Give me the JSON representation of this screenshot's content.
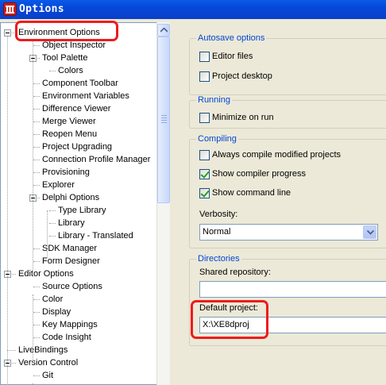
{
  "window": {
    "title": "Options"
  },
  "tree": {
    "items": [
      {
        "label": "Environment Options",
        "level": 0,
        "expanded": true
      },
      {
        "label": "Object Inspector",
        "level": 1
      },
      {
        "label": "Tool Palette",
        "level": 1,
        "expanded": true
      },
      {
        "label": "Colors",
        "level": 2
      },
      {
        "label": "Component Toolbar",
        "level": 1
      },
      {
        "label": "Environment Variables",
        "level": 1
      },
      {
        "label": "Difference Viewer",
        "level": 1
      },
      {
        "label": "Merge Viewer",
        "level": 1
      },
      {
        "label": "Reopen Menu",
        "level": 1
      },
      {
        "label": "Project Upgrading",
        "level": 1
      },
      {
        "label": "Connection Profile Manager",
        "level": 1
      },
      {
        "label": "Provisioning",
        "level": 1
      },
      {
        "label": "Explorer",
        "level": 1
      },
      {
        "label": "Delphi Options",
        "level": 1,
        "expanded": true
      },
      {
        "label": "Type Library",
        "level": 2
      },
      {
        "label": "Library",
        "level": 2
      },
      {
        "label": "Library - Translated",
        "level": 2
      },
      {
        "label": "SDK Manager",
        "level": 1
      },
      {
        "label": "Form Designer",
        "level": 1
      },
      {
        "label": "Editor Options",
        "level": 0,
        "expanded": true
      },
      {
        "label": "Source Options",
        "level": 1
      },
      {
        "label": "Color",
        "level": 1
      },
      {
        "label": "Display",
        "level": 1
      },
      {
        "label": "Key Mappings",
        "level": 1
      },
      {
        "label": "Code Insight",
        "level": 1
      },
      {
        "label": "LiveBindings",
        "level": 0
      },
      {
        "label": "Version Control",
        "level": 0,
        "expanded": true
      },
      {
        "label": "Git",
        "level": 1
      }
    ]
  },
  "autosave": {
    "title": "Autosave options",
    "editor_files": {
      "label": "Editor files",
      "checked": false
    },
    "project_desktop": {
      "label": "Project desktop",
      "checked": false
    }
  },
  "running": {
    "title": "Running",
    "minimize_on_run": {
      "label": "Minimize on run",
      "checked": false
    }
  },
  "compiling": {
    "title": "Compiling",
    "always_compile": {
      "label": "Always compile modified projects",
      "checked": false
    },
    "show_progress": {
      "label": "Show compiler progress",
      "checked": true
    },
    "show_command_line": {
      "label": "Show command line",
      "checked": true
    },
    "verbosity_label": "Verbosity:",
    "verbosity_value": "Normal"
  },
  "directories": {
    "title": "Directories",
    "shared_repository_label": "Shared repository:",
    "shared_repository_value": "",
    "default_project_label": "Default project:",
    "default_project_value": "X:\\XE8dproj"
  },
  "colors": {
    "highlight": "#ee1c1c",
    "group_title": "#0046d5",
    "titlebar": "#0548d8",
    "check": "#21a121"
  }
}
